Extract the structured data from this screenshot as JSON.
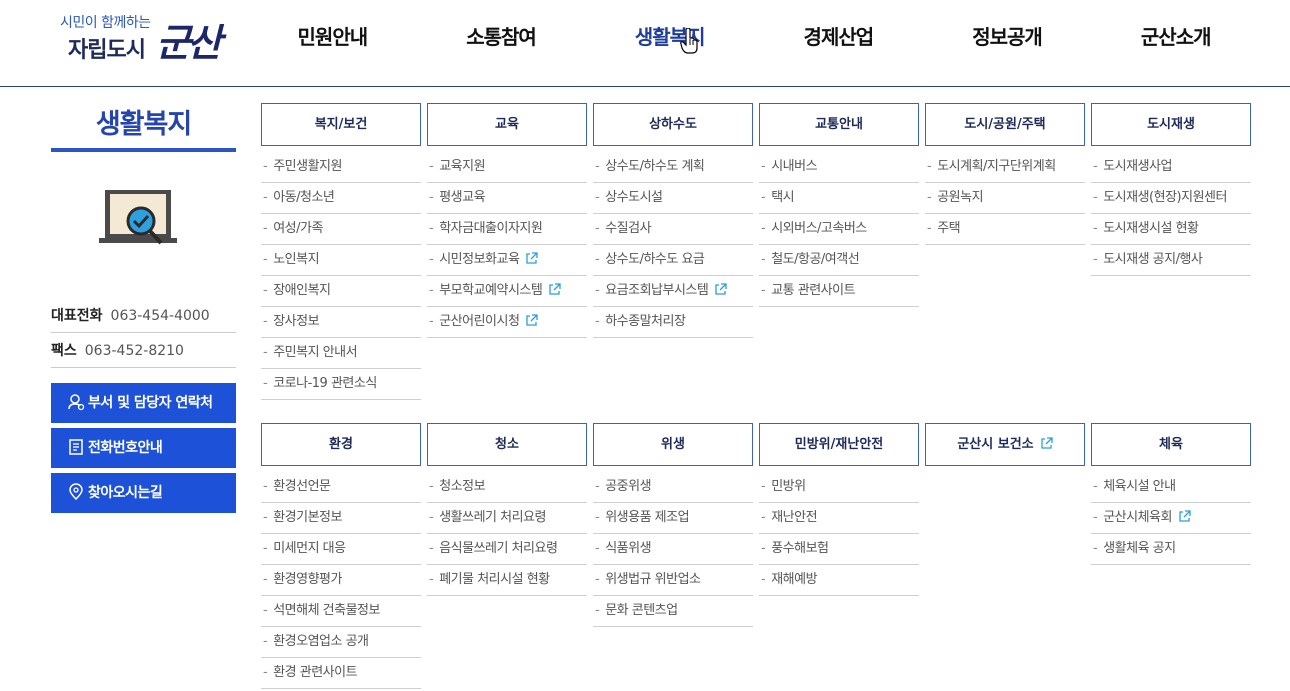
{
  "header": {
    "logo": {
      "sub": "시민이 함께하는",
      "main": "자립도시",
      "brand": "군산"
    },
    "nav": [
      "민원안내",
      "소통참여",
      "생활복지",
      "경제산업",
      "정보공개",
      "군산소개"
    ],
    "active_index": 2
  },
  "sidebar": {
    "title": "생활복지",
    "phone_label": "대표전화",
    "phone_value": "063-454-4000",
    "fax_label": "팩스",
    "fax_value": "063-452-8210",
    "buttons": [
      "부서 및 담당자 연락처",
      "전화번호안내",
      "찾아오시는길"
    ]
  },
  "menu": {
    "columns": [
      {
        "title": "복지/보건",
        "items": [
          "주민생활지원",
          "아동/청소년",
          "여성/가족",
          "노인복지",
          "장애인복지",
          "장사정보",
          "주민복지 안내서",
          "코로나-19 관련소식"
        ]
      },
      {
        "title": "교육",
        "items": [
          "교육지원",
          "평생교육",
          "학자금대출이자지원",
          "시민정보화교육",
          "부모학교예약시스템",
          "군산어린이시청"
        ]
      },
      {
        "title": "상하수도",
        "items": [
          "상수도/하수도 계획",
          "상수도시설",
          "수질검사",
          "상수도/하수도 요금",
          "요금조회납부시스템",
          "하수종말처리장"
        ]
      },
      {
        "title": "교통안내",
        "items": [
          "시내버스",
          "택시",
          "시외버스/고속버스",
          "철도/항공/여객선",
          "교통 관련사이트"
        ]
      },
      {
        "title": "도시/공원/주택",
        "items": [
          "도시계획/지구단위계획",
          "공원녹지",
          "주택"
        ]
      },
      {
        "title": "도시재생",
        "items": [
          "도시재생사업",
          "도시재생(현장)지원센터",
          "도시재생시설 현황",
          "도시재생 공지/행사"
        ]
      },
      {
        "title": "환경",
        "items": [
          "환경선언문",
          "환경기본정보",
          "미세먼지 대응",
          "환경영향평가",
          "석면해체 건축물정보",
          "환경오염업소 공개",
          "환경 관련사이트"
        ]
      },
      {
        "title": "청소",
        "items": [
          "청소정보",
          "생활쓰레기 처리요령",
          "음식물쓰레기 처리요령",
          "폐기물 처리시설 현황"
        ]
      },
      {
        "title": "위생",
        "items": [
          "공중위생",
          "위생용품 제조업",
          "식품위생",
          "위생법규 위반업소",
          "문화 콘텐츠업"
        ]
      },
      {
        "title": "민방위/재난안전",
        "items": [
          "민방위",
          "재난안전",
          "풍수해보험",
          "재해예방"
        ]
      },
      {
        "title": "군산시 보건소",
        "items": []
      },
      {
        "title": "체육",
        "items": [
          "체육시설 안내",
          "군산시체육회",
          "생활체육 공지"
        ]
      }
    ]
  },
  "colors": {
    "accent": "#1d52d8",
    "title_blue": "#2445ad",
    "border": "#3a63c0",
    "ext_icon": "#2a9fd8"
  }
}
